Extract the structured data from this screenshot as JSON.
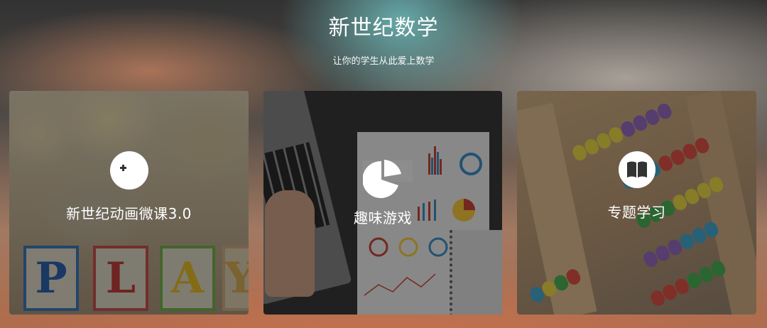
{
  "header": {
    "title": "新世纪数学",
    "subtitle": "让你的学生从此爱上数学"
  },
  "cards": [
    {
      "label": "新世纪动画微课3.0",
      "icon": "pacman-icon"
    },
    {
      "label": "趣味游戏",
      "icon": "pie-chart-icon"
    },
    {
      "label": "专题学习",
      "icon": "book-icon"
    }
  ],
  "colors": {
    "text": "#ffffff",
    "overlay": "#141414",
    "accent_teal": "#78c8c8"
  }
}
